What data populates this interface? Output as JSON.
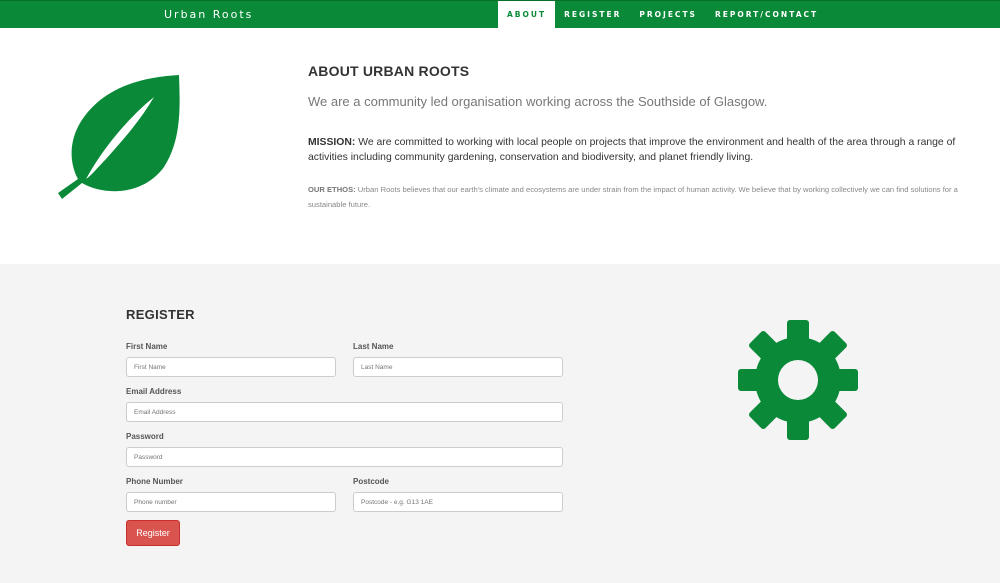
{
  "navbar": {
    "brand": "Urban Roots",
    "items": [
      {
        "label": "ABOUT",
        "active": true
      },
      {
        "label": "REGISTER",
        "active": false
      },
      {
        "label": "PROJECTS",
        "active": false
      },
      {
        "label": "REPORT/CONTACT",
        "active": false
      }
    ]
  },
  "about": {
    "title": "ABOUT URBAN ROOTS",
    "lead": "We are a community led organisation working across the Southside of Glasgow.",
    "mission_label": "MISSION:",
    "mission_text": " We are committed to working with local people on projects that improve the environment and health of the area through a range of activities including community gardening, conservation and biodiversity, and planet friendly living.",
    "ethos_label": "OUR ETHOS:",
    "ethos_text": " Urban Roots believes that our earth's climate and ecosystems are under strain from the impact of human activity. We believe that by working collectively we can find solutions for a sustainable future.",
    "icon": "leaf-icon"
  },
  "register": {
    "title": "REGISTER",
    "first_name": {
      "label": "First Name",
      "placeholder": "First Name",
      "value": ""
    },
    "last_name": {
      "label": "Last Name",
      "placeholder": "Last Name",
      "value": ""
    },
    "email": {
      "label": "Email Address",
      "placeholder": "Email Address",
      "value": ""
    },
    "password": {
      "label": "Password",
      "placeholder": "Password",
      "value": ""
    },
    "phone": {
      "label": "Phone Number",
      "placeholder": "Phone number",
      "value": ""
    },
    "postcode": {
      "label": "Postcode",
      "placeholder": "Postcode - e.g. G13 1AE",
      "value": ""
    },
    "submit_label": "Register",
    "icon": "gear-icon"
  },
  "colors": {
    "brand_green": "#0a8a38",
    "button_red": "#d9534f",
    "section_gray": "#f4f4f4"
  }
}
